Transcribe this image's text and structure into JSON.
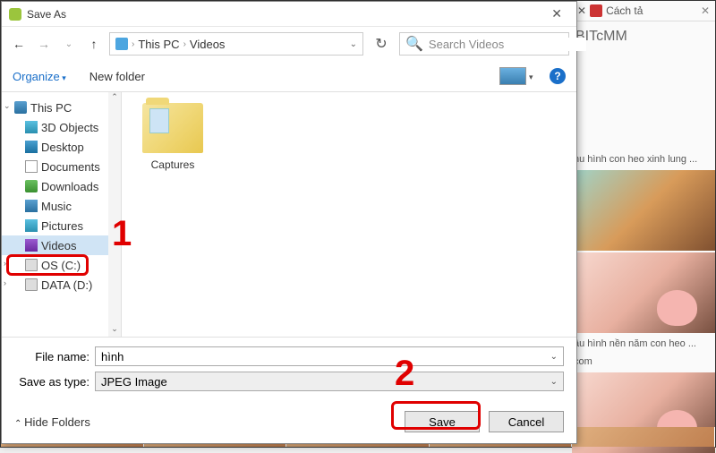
{
  "dialog": {
    "title": "Save As",
    "nav": {
      "this_pc": "This PC",
      "videos": "Videos"
    },
    "search_placeholder": "Search Videos",
    "organize": "Organize",
    "new_folder": "New folder",
    "help_glyph": "?",
    "tree": {
      "this_pc": "This PC",
      "objects3d": "3D Objects",
      "desktop": "Desktop",
      "documents": "Documents",
      "downloads": "Downloads",
      "music": "Music",
      "pictures": "Pictures",
      "videos": "Videos",
      "os_c": "OS (C:)",
      "data_d": "DATA (D:)"
    },
    "content": {
      "captures": "Captures"
    },
    "file_name_label": "File name:",
    "file_name_value": "hình",
    "save_type_label": "Save as type:",
    "save_type_value": "JPEG Image",
    "hide_folders": "Hide Folders",
    "save": "Save",
    "cancel": "Cancel"
  },
  "annotations": {
    "one": "1",
    "two": "2"
  },
  "bg": {
    "tab_label": "Cách tả",
    "tab_x": "✕",
    "title": "BITcMM",
    "snip1": "hu hình con heo xinh lung ...",
    "snip2": "ầu hình nền năm con heo ...",
    "snip2b": "com"
  }
}
